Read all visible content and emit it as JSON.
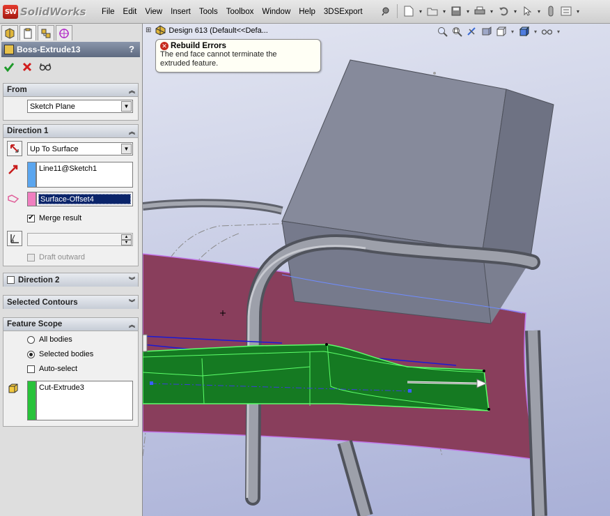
{
  "app": {
    "logo_badge": "SW",
    "name": "SolidWorks"
  },
  "menu": [
    "File",
    "Edit",
    "View",
    "Insert",
    "Tools",
    "Toolbox",
    "Window",
    "Help",
    "3DSExport"
  ],
  "toolbar_icons": [
    "pin-icon",
    "new-document-icon",
    "open-icon",
    "save-icon",
    "print-icon",
    "undo-icon",
    "select-icon",
    "rebuild-icon",
    "options-icon"
  ],
  "pm": {
    "tabs": [
      "feature-manager-icon",
      "property-manager-icon",
      "configuration-manager-icon",
      "dimxpert-icon"
    ],
    "title": "Boss-Extrude13",
    "help": "?",
    "from": {
      "header": "From",
      "start_condition": "Sketch Plane"
    },
    "direction1": {
      "header": "Direction 1",
      "end_condition": "Up To Surface",
      "direction_ref": "Line11@Sketch1",
      "face_ref": "Surface-Offset4",
      "merge_result": "Merge result",
      "merge_checked": true,
      "draft_value": "",
      "draft_outward": "Draft outward"
    },
    "direction2": {
      "header": "Direction 2"
    },
    "selected_contours": {
      "header": "Selected Contours"
    },
    "feature_scope": {
      "header": "Feature Scope",
      "all_bodies": "All bodies",
      "selected_bodies": "Selected bodies",
      "auto_select": "Auto-select",
      "bodies": [
        "Cut-Extrude3"
      ]
    }
  },
  "viewport": {
    "tree_path": "Design 613  (Default<<Defa...",
    "error_title": "Rebuild Errors",
    "error_message_line1": "The end face cannot terminate the",
    "error_message_line2": "extruded feature.",
    "colors": {
      "surface": "#893e5c",
      "preview": "#1fa02d",
      "steel": "#8b8e98",
      "block": "#7b7f90"
    }
  }
}
